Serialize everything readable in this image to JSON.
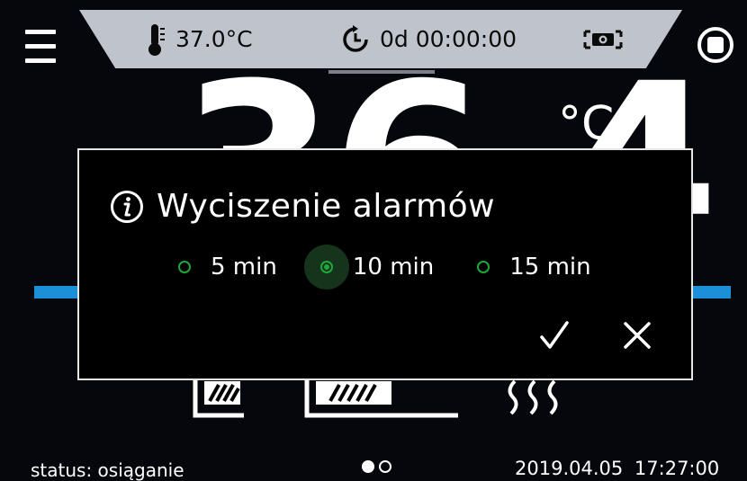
{
  "top_bar": {
    "menu_icon": "menu-icon",
    "temperature": "37.0°C",
    "timer": "0d 00:00:00",
    "camera_icon": "camera-icon",
    "stop_icon": "stop-icon"
  },
  "main_display": {
    "value": "36.4",
    "unit": "°C"
  },
  "dialog": {
    "title": "Wyciszenie alarmów",
    "icon": "info-icon",
    "options": [
      {
        "label": "5 min",
        "selected": false
      },
      {
        "label": "10 min",
        "selected": true
      },
      {
        "label": "15 min",
        "selected": false
      }
    ],
    "confirm_icon": "check-icon",
    "cancel_icon": "close-icon"
  },
  "status_bar": {
    "status": "status: osiąganie",
    "page_count": 2,
    "active_page": 1,
    "datetime": "2019.04.05 17:27:00"
  },
  "colors": {
    "background": "#05070d",
    "panel": "#bfc3cc",
    "accent_green": "#1fa83a",
    "accent_blue": "#1b8fd8"
  }
}
